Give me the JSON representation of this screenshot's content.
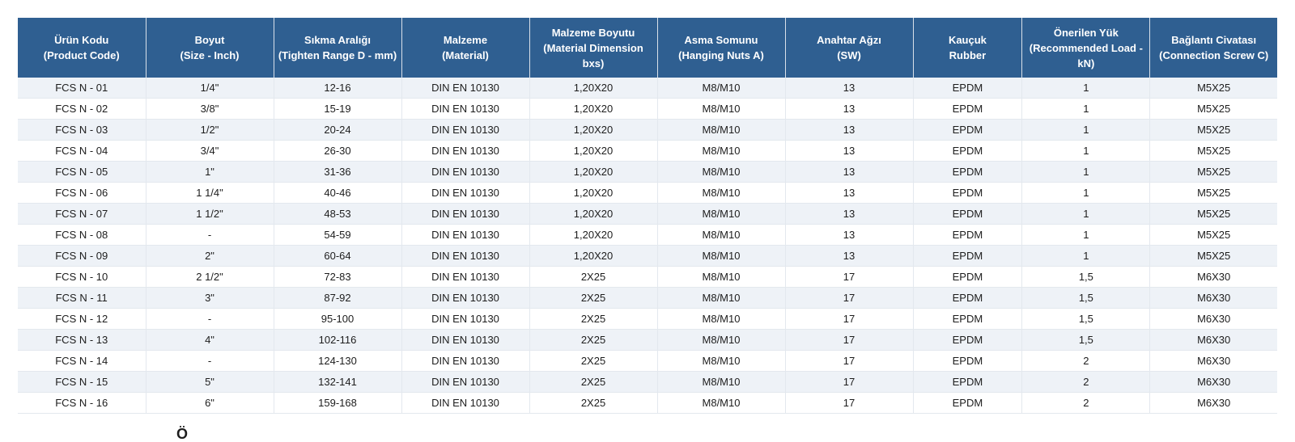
{
  "table": {
    "headers": [
      {
        "line1": "Ürün Kodu",
        "line2": "(Product Code)"
      },
      {
        "line1": "Boyut",
        "line2": "(Size - Inch)"
      },
      {
        "line1": "Sıkma Aralığı",
        "line2": "(Tighten Range D - mm)"
      },
      {
        "line1": "Malzeme",
        "line2": "(Material)"
      },
      {
        "line1": "Malzeme Boyutu",
        "line2": "(Material Dimension bxs)"
      },
      {
        "line1": "Asma Somunu",
        "line2": "(Hanging Nuts A)"
      },
      {
        "line1": "Anahtar Ağzı",
        "line2": "(SW)"
      },
      {
        "line1": "Kauçuk",
        "line2": "Rubber"
      },
      {
        "line1": "Önerilen Yük",
        "line2": "(Recommended Load -",
        "line3": "kN)"
      },
      {
        "line1": "Bağlantı Civatası",
        "line2": "(Connection Screw C)"
      }
    ],
    "rows": [
      [
        "FCS N - 01",
        "1/4\"",
        "12-16",
        "DIN EN 10130",
        "1,20X20",
        "M8/M10",
        "13",
        "EPDM",
        "1",
        "M5X25"
      ],
      [
        "FCS N - 02",
        "3/8\"",
        "15-19",
        "DIN EN 10130",
        "1,20X20",
        "M8/M10",
        "13",
        "EPDM",
        "1",
        "M5X25"
      ],
      [
        "FCS N - 03",
        "1/2\"",
        "20-24",
        "DIN EN 10130",
        "1,20X20",
        "M8/M10",
        "13",
        "EPDM",
        "1",
        "M5X25"
      ],
      [
        "FCS N - 04",
        "3/4\"",
        "26-30",
        "DIN EN 10130",
        "1,20X20",
        "M8/M10",
        "13",
        "EPDM",
        "1",
        "M5X25"
      ],
      [
        "FCS N - 05",
        "1\"",
        "31-36",
        "DIN EN 10130",
        "1,20X20",
        "M8/M10",
        "13",
        "EPDM",
        "1",
        "M5X25"
      ],
      [
        "FCS N - 06",
        "1 1/4\"",
        "40-46",
        "DIN EN 10130",
        "1,20X20",
        "M8/M10",
        "13",
        "EPDM",
        "1",
        "M5X25"
      ],
      [
        "FCS N - 07",
        "1 1/2\"",
        "48-53",
        "DIN EN 10130",
        "1,20X20",
        "M8/M10",
        "13",
        "EPDM",
        "1",
        "M5X25"
      ],
      [
        "FCS N - 08",
        "-",
        "54-59",
        "DIN EN 10130",
        "1,20X20",
        "M8/M10",
        "13",
        "EPDM",
        "1",
        "M5X25"
      ],
      [
        "FCS N - 09",
        "2\"",
        "60-64",
        "DIN EN 10130",
        "1,20X20",
        "M8/M10",
        "13",
        "EPDM",
        "1",
        "M5X25"
      ],
      [
        "FCS N - 10",
        "2 1/2\"",
        "72-83",
        "DIN EN 10130",
        "2X25",
        "M8/M10",
        "17",
        "EPDM",
        "1,5",
        "M6X30"
      ],
      [
        "FCS N - 11",
        "3\"",
        "87-92",
        "DIN EN 10130",
        "2X25",
        "M8/M10",
        "17",
        "EPDM",
        "1,5",
        "M6X30"
      ],
      [
        "FCS N - 12",
        "-",
        "95-100",
        "DIN EN 10130",
        "2X25",
        "M8/M10",
        "17",
        "EPDM",
        "1,5",
        "M6X30"
      ],
      [
        "FCS N - 13",
        "4\"",
        "102-116",
        "DIN EN 10130",
        "2X25",
        "M8/M10",
        "17",
        "EPDM",
        "1,5",
        "M6X30"
      ],
      [
        "FCS N - 14",
        "-",
        "124-130",
        "DIN EN 10130",
        "2X25",
        "M8/M10",
        "17",
        "EPDM",
        "2",
        "M6X30"
      ],
      [
        "FCS N - 15",
        "5\"",
        "132-141",
        "DIN EN 10130",
        "2X25",
        "M8/M10",
        "17",
        "EPDM",
        "2",
        "M6X30"
      ],
      [
        "FCS N - 16",
        "6\"",
        "159-168",
        "DIN EN 10130",
        "2X25",
        "M8/M10",
        "17",
        "EPDM",
        "2",
        "M6X30"
      ]
    ]
  },
  "footer": {
    "partial_glyph": "Ö"
  },
  "colors": {
    "header_bg": "#2f5f91",
    "row_alt_bg": "#eef2f7"
  }
}
